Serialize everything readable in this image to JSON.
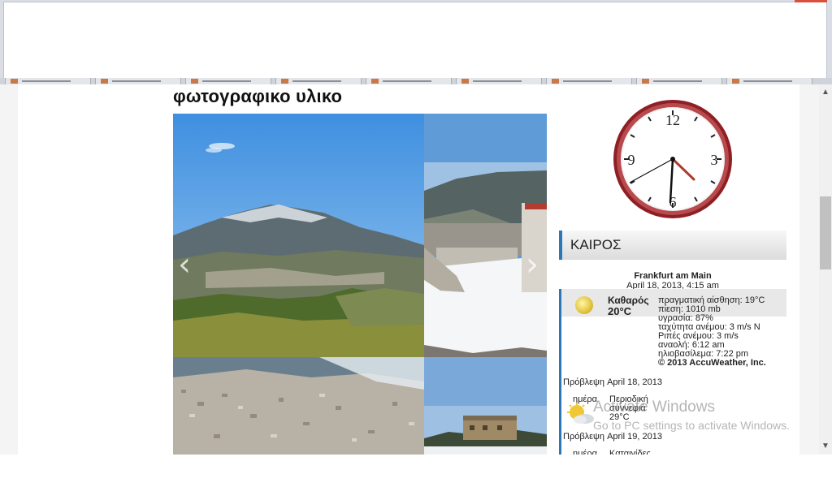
{
  "gallery": {
    "title": "φωτογραφικο υλικο",
    "prev_arrow": "‹",
    "next_arrow": "›"
  },
  "clock": {
    "numerals": [
      "12",
      "3",
      "6",
      "9"
    ],
    "time_shown": "4:15"
  },
  "weather": {
    "header": "ΚΑΙΡΟΣ",
    "city": "Frankfurt am Main",
    "datetime": "April 18, 2013, 4:15 am",
    "current": {
      "condition": "Καθαρός",
      "temperature": "20°C",
      "details": [
        "πραγματική αίσθηση: 19°C",
        "πίεση: 1010 mb",
        "υγρασία: 87%",
        "ταχύτητα ανέμου: 3 m/s N",
        "Ριπές ανέμου: 3 m/s",
        "αναολή: 6:12 am",
        "ηλιοβασίλεμα: 7:22 pm"
      ],
      "copyright": "© 2013 AccuWeather, Inc."
    },
    "forecast": [
      {
        "heading": "Πρόβλεψη April 18, 2013",
        "period": "ημέρα",
        "condition_line1": "Περιοδική",
        "condition_line2": "συννεφιά",
        "temp": "29°C"
      },
      {
        "heading": "Πρόβλεψη April 19, 2013",
        "period": "ημέρα",
        "condition_line1": "Καταιγίδες"
      }
    ]
  },
  "watermark": {
    "line1": "Activate Windows",
    "line2": "Go to PC settings to activate Windows."
  },
  "colors": {
    "accent": "#2b77b8",
    "clock_rim": "#a0262a"
  }
}
